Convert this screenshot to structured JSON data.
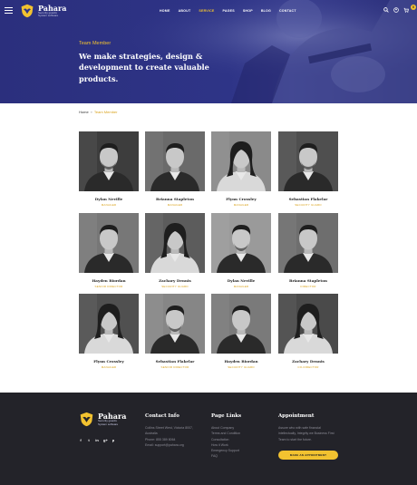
{
  "header": {
    "brand": "Pahara",
    "brand_tagline_1": "Security guards",
    "brand_tagline_2": "System software",
    "nav": [
      "HOME",
      "ABOUT",
      "SERVICE",
      "PAGES",
      "SHOP",
      "BLOG",
      "CONTACT"
    ],
    "active_nav": "SERVICE",
    "cart_count": "0"
  },
  "hero": {
    "kicker": "Team Member",
    "title": "We make strategies, design & development to create valuable products."
  },
  "breadcrumb": {
    "home": "Home",
    "sep": "»",
    "current": "Team Member"
  },
  "team": [
    {
      "name": "Dylan Neville",
      "role": "MANAGER"
    },
    {
      "name": "Brianna Stapleton",
      "role": "MANAGER"
    },
    {
      "name": "Flynn Crossley",
      "role": "MANAGER"
    },
    {
      "name": "Sebastian Flakelar",
      "role": "SECURITY GUARD"
    },
    {
      "name": "Hayden Riordan",
      "role": "SENIOR DIRECTOR"
    },
    {
      "name": "Zachary Dennis",
      "role": "SECURITY GUARD"
    },
    {
      "name": "Dylan Neville",
      "role": "MANAGER"
    },
    {
      "name": "Brianna Stapleton",
      "role": "DIRECTOR"
    },
    {
      "name": "Flynn Crossley",
      "role": "MANAGER"
    },
    {
      "name": "Sebastian Flakelar",
      "role": "SENIOR DIRECTOR"
    },
    {
      "name": "Hayden Riordan",
      "role": "SECURITY GUARD"
    },
    {
      "name": "Zachary Dennis",
      "role": "CO-DIRECTOR"
    }
  ],
  "footer": {
    "social_icons": [
      "facebook-icon",
      "twitter-icon",
      "linkedin-icon",
      "google-plus-icon",
      "pinterest-icon"
    ],
    "social_glyphs": [
      "f",
      "t",
      "in",
      "g+",
      "p"
    ],
    "contact": {
      "heading": "Contact Info",
      "lines": [
        "Collins Street West, Victoria 8007,",
        "Australia",
        "Phone: 855 389 8064",
        "Email: support@pahara.org"
      ]
    },
    "links": {
      "heading": "Page Links",
      "items": [
        "About Company",
        "Terms and Condition",
        "Consultation",
        "How it Work",
        "Emergency Support",
        "FAQ"
      ]
    },
    "appointment": {
      "heading": "Appointment",
      "lines": [
        "Assure who with safe financial",
        "intellectually, Integrity we Business First",
        "Team to start the future."
      ],
      "button": "MAKE AN APPOINTMENT"
    }
  },
  "colors": {
    "hero_blue": "#2e3487",
    "accent_gold": "#f2c230",
    "footer_dark": "#232329"
  }
}
